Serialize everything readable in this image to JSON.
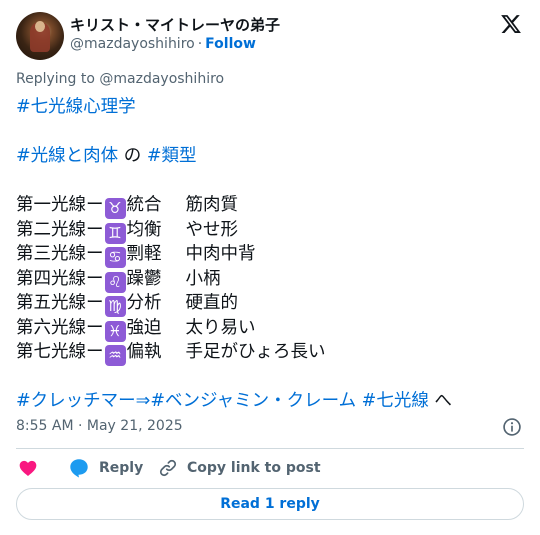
{
  "author": {
    "display_name": "キリスト・マイトレーヤの弟子",
    "handle": "@mazdayoshihiro",
    "follow_label": "Follow",
    "separator": "·"
  },
  "platform_icon": "x-logo-icon",
  "reply_to": "Replying to @mazdayoshihiro",
  "tweet": {
    "tag_main": "#七光線心理学",
    "line2": {
      "tag_a": "#光線と肉体",
      "middle": " の ",
      "tag_b": "#類型"
    },
    "rays": [
      {
        "prefix": "第一光線ー",
        "symbol": "♉",
        "trait": "統合",
        "body": "筋肉質"
      },
      {
        "prefix": "第二光線ー",
        "symbol": "♊",
        "trait": "均衡",
        "body": "やせ形"
      },
      {
        "prefix": "第三光線ー",
        "symbol": "♋",
        "trait": "剽軽",
        "body": "中肉中背"
      },
      {
        "prefix": "第四光線ー",
        "symbol": "♌",
        "trait": "躁鬱",
        "body": "小柄"
      },
      {
        "prefix": "第五光線ー",
        "symbol": "♍",
        "trait": "分析",
        "body": "硬直的"
      },
      {
        "prefix": "第六光線ー",
        "symbol": "♓",
        "trait": "強迫",
        "body": "太り易い"
      },
      {
        "prefix": "第七光線ー",
        "symbol": "♒",
        "trait": "偏執",
        "body": "手足がひょろ長い"
      }
    ],
    "final": {
      "tag_a": "#クレッチマー⇒#ベンジャミン・クレーム",
      "space": " ",
      "tag_b": "#七光線",
      "suffix": " へ"
    }
  },
  "timestamp": "8:55 AM · May 21, 2025",
  "actions": {
    "like_label": "",
    "reply_label": "Reply",
    "copy_label": "Copy link to post"
  },
  "read_reply_label": "Read 1 reply",
  "colors": {
    "link": "#006fd6",
    "text": "#0f1419",
    "muted": "#536471",
    "zodiac_bg": "#8d5bd6",
    "heart": "#f91880",
    "reply_bubble": "#1d9bf0"
  }
}
